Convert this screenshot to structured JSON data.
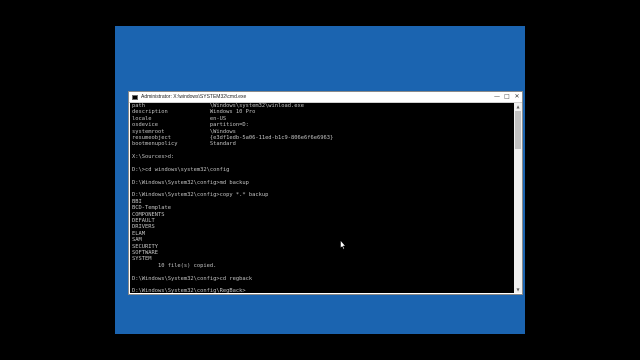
{
  "window": {
    "title": "Administrator: X:\\windows\\SYSTEM32\\cmd.exe",
    "controls": {
      "minimize": "—",
      "maximize": "□",
      "close": "✕"
    }
  },
  "console": {
    "lines": [
      "path                    \\Windows\\system32\\winload.exe",
      "description             Windows 10 Pro",
      "locale                  en-US",
      "osdevice                partition=D:",
      "systemroot              \\Windows",
      "resumeobject            {e3df1edb-5a06-11ed-b1c9-806e6f6e6963}",
      "bootmenupolicy          Standard",
      "",
      "X:\\Sources>d:",
      "",
      "D:\\>cd windows\\system32\\config",
      "",
      "D:\\Windows\\System32\\config>md backup",
      "",
      "D:\\Windows\\System32\\config>copy *.* backup",
      "BBI",
      "BCD-Template",
      "COMPONENTS",
      "DEFAULT",
      "DRIVERS",
      "ELAM",
      "SAM",
      "SECURITY",
      "SOFTWARE",
      "SYSTEM",
      "        10 file(s) copied.",
      "",
      "D:\\Windows\\System32\\config>cd regback",
      "",
      "D:\\Windows\\System32\\config\\RegBack>"
    ]
  },
  "scrollbar": {
    "up_icon": "▲",
    "down_icon": "▼"
  },
  "colors": {
    "desktop": "#1b64b0",
    "console_bg": "#000000",
    "console_text": "#c0c0c0"
  }
}
